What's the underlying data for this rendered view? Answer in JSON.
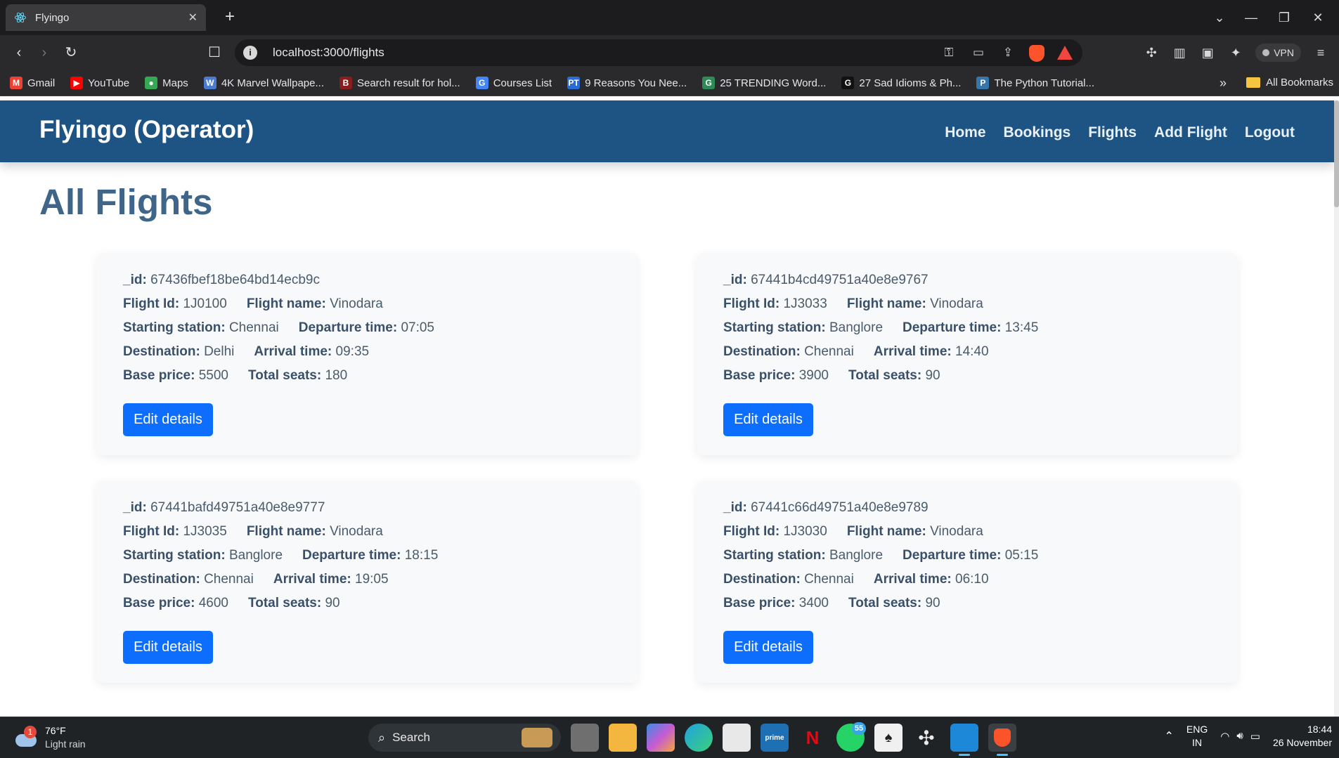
{
  "browser": {
    "tab": {
      "title": "Flyingo"
    },
    "url": "localhost:3000/flights",
    "vpn_label": "VPN",
    "bookmarks": [
      {
        "label": "Gmail",
        "icon": "gmail-icon",
        "color": "#ea4335",
        "glyph": "M"
      },
      {
        "label": "YouTube",
        "icon": "youtube-icon",
        "color": "#ff0000",
        "glyph": "▶"
      },
      {
        "label": "Maps",
        "icon": "maps-icon",
        "color": "#34a853",
        "glyph": "●"
      },
      {
        "label": "4K Marvel Wallpape...",
        "icon": "wallpaper-site-icon",
        "color": "#4a7bd0",
        "glyph": "W"
      },
      {
        "label": "Search result for hol...",
        "icon": "search-site-icon",
        "color": "#8a1e1e",
        "glyph": "B"
      },
      {
        "label": "Courses List",
        "icon": "google-icon",
        "color": "#4285f4",
        "glyph": "G"
      },
      {
        "label": "9 Reasons You Nee...",
        "icon": "article-site-icon",
        "color": "#2b6cd4",
        "glyph": "PT"
      },
      {
        "label": "25 TRENDING Word...",
        "icon": "word-site-icon",
        "color": "#2e8b57",
        "glyph": "G"
      },
      {
        "label": "27 Sad Idioms & Ph...",
        "icon": "idioms-site-icon",
        "color": "#111111",
        "glyph": "G"
      },
      {
        "label": "The Python Tutorial...",
        "icon": "python-icon",
        "color": "#3776ab",
        "glyph": "P"
      }
    ],
    "all_bookmarks_label": "All Bookmarks"
  },
  "app": {
    "brand": "Flyingo (Operator)",
    "nav": [
      "Home",
      "Bookings",
      "Flights",
      "Add Flight",
      "Logout"
    ],
    "page_title": "All Flights",
    "labels": {
      "id": "_id:",
      "flight_id": "Flight Id:",
      "flight_name": "Flight name:",
      "starting_station": "Starting station:",
      "departure_time": "Departure time:",
      "destination": "Destination:",
      "arrival_time": "Arrival time:",
      "base_price": "Base price:",
      "total_seats": "Total seats:"
    },
    "edit_button_label": "Edit details",
    "flights": [
      {
        "id": "67436fbef18be64bd14ecb9c",
        "flight_id": "1J0100",
        "flight_name": "Vinodara",
        "starting_station": "Chennai",
        "departure_time": "07:05",
        "destination": "Delhi",
        "arrival_time": "09:35",
        "base_price": "5500",
        "total_seats": "180"
      },
      {
        "id": "67441b4cd49751a40e8e9767",
        "flight_id": "1J3033",
        "flight_name": "Vinodara",
        "starting_station": "Banglore",
        "departure_time": "13:45",
        "destination": "Chennai",
        "arrival_time": "14:40",
        "base_price": "3900",
        "total_seats": "90"
      },
      {
        "id": "67441bafd49751a40e8e9777",
        "flight_id": "1J3035",
        "flight_name": "Vinodara",
        "starting_station": "Banglore",
        "departure_time": "18:15",
        "destination": "Chennai",
        "arrival_time": "19:05",
        "base_price": "4600",
        "total_seats": "90"
      },
      {
        "id": "67441c66d49751a40e8e9789",
        "flight_id": "1J3030",
        "flight_name": "Vinodara",
        "starting_station": "Banglore",
        "departure_time": "05:15",
        "destination": "Chennai",
        "arrival_time": "06:10",
        "base_price": "3400",
        "total_seats": "90"
      }
    ]
  },
  "taskbar": {
    "weather": {
      "temp": "76°F",
      "condition": "Light rain",
      "badge": "1"
    },
    "search_label": "Search",
    "whatsapp_badge": "55",
    "language": {
      "line1": "ENG",
      "line2": "IN"
    },
    "clock": {
      "time": "18:44",
      "date": "26 November"
    }
  },
  "colors": {
    "navbar": "#1d5484",
    "title": "#3f6588",
    "button": "#0d6efd",
    "card": "#f8f9fa"
  }
}
